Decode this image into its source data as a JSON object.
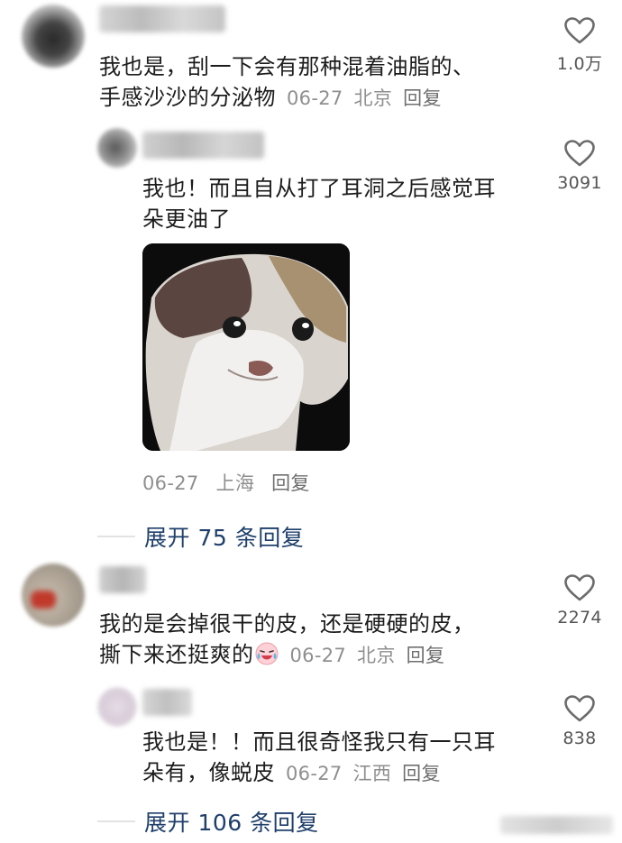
{
  "comments": [
    {
      "text_line1": "我也是，刮一下会有那种混着油脂的、",
      "text_line2": "手感沙沙的分泌物",
      "date": "06-27",
      "location": "北京",
      "reply_label": "回复",
      "likes": "1.0万"
    },
    {
      "text_line1": "我也！而且自从打了耳洞之后感觉耳",
      "text_line2": "朵更油了",
      "date": "06-27",
      "location": "上海",
      "reply_label": "回复",
      "likes": "3091"
    },
    {
      "text_line1": "我的是会掉很干的皮，还是硬硬的皮，",
      "text_line2": "撕下来还挺爽的",
      "emoji": "crying-laughing-emoji",
      "date": "06-27",
      "location": "北京",
      "reply_label": "回复",
      "likes": "2274"
    },
    {
      "text_line1": "我也是！！而且很奇怪我只有一只耳",
      "text_line2": "朵有，像蜕皮",
      "date": "06-27",
      "location": "江西",
      "reply_label": "回复",
      "likes": "838"
    }
  ],
  "expand_replies": [
    {
      "label": "展开 75 条回复"
    },
    {
      "label": "展开 106 条回复"
    }
  ],
  "icons": {
    "like": "heart-outline-icon",
    "sticker": "sad-cat-sticker"
  },
  "colors": {
    "link": "#1f3f6b",
    "meta": "#8f8f8f",
    "text": "#1c1c1c"
  }
}
